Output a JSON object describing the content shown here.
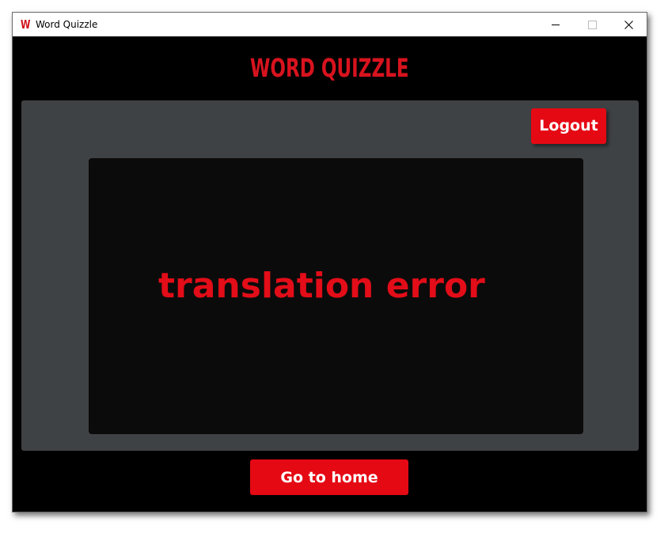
{
  "window": {
    "title": "Word Quizzle",
    "app_icon_letter": "W",
    "app_icon_name": "word-quizzle-app-icon",
    "controls": {
      "minimize_icon": "minimize-icon",
      "maximize_icon": "maximize-icon",
      "close_icon": "close-icon",
      "close_glyph": "✕"
    }
  },
  "header": {
    "brand": "WORD QUIZZLE"
  },
  "panel": {
    "logout_label": "Logout",
    "message": "translation error"
  },
  "footer": {
    "home_label": "Go to home"
  },
  "colors": {
    "accent": "#e50914",
    "panel_bg": "#3f4245",
    "card_bg": "#0b0b0b",
    "window_bg": "#000000",
    "text_light": "#ffffff"
  }
}
